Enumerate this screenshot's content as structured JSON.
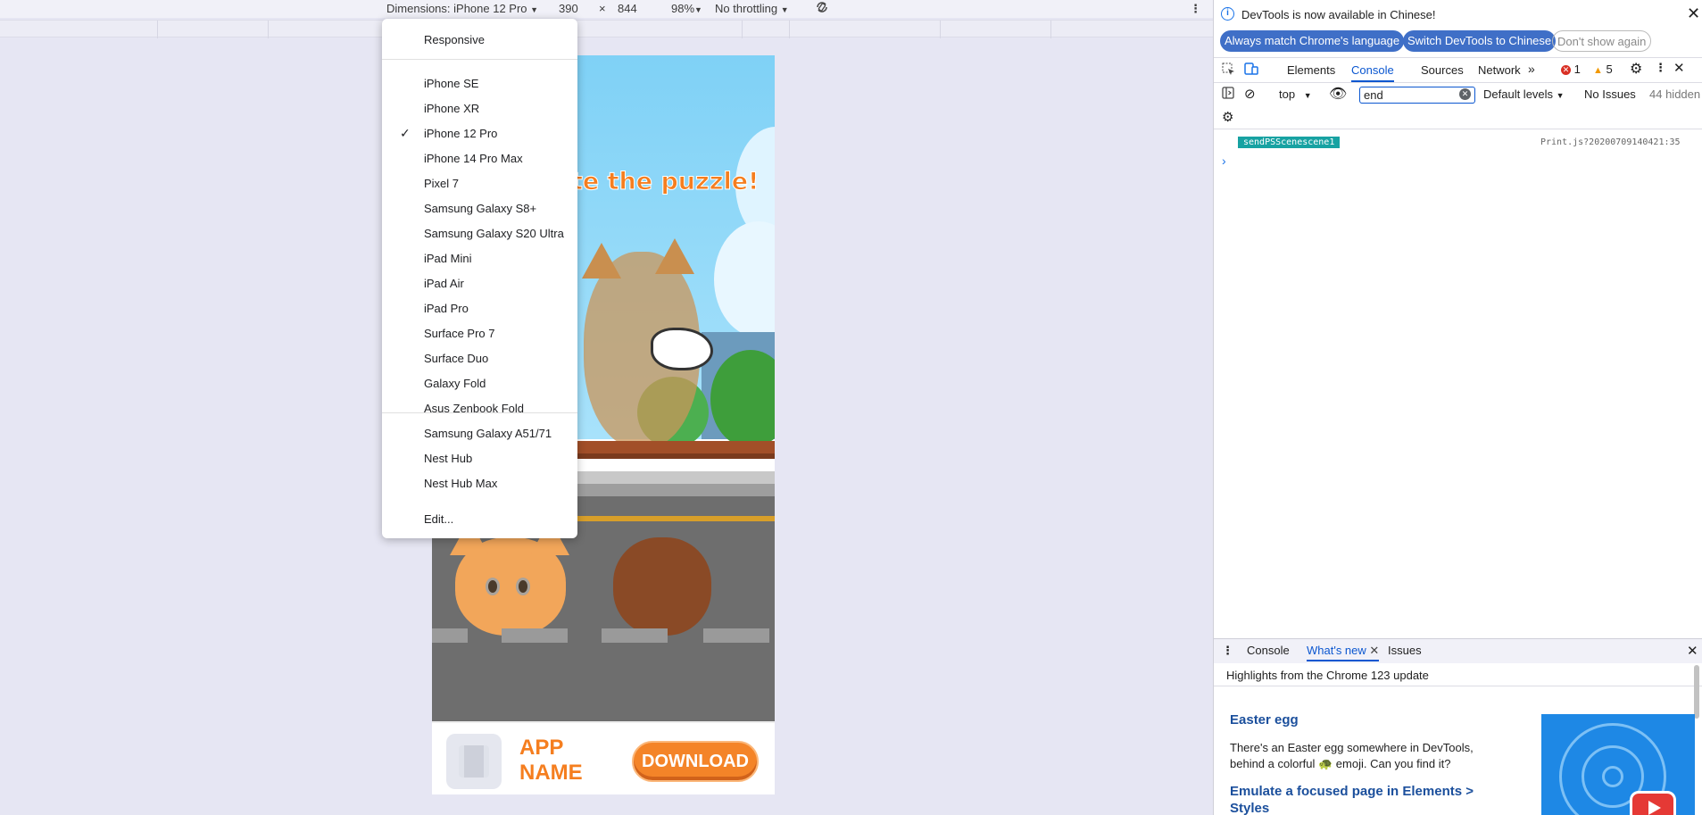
{
  "device_toolbar": {
    "dimensions_label": "Dimensions: iPhone 12 Pro",
    "width": "390",
    "times": "×",
    "height": "844",
    "zoom": "98%",
    "throttling": "No throttling"
  },
  "device_menu": {
    "responsive": "Responsive",
    "devices": [
      "iPhone SE",
      "iPhone XR",
      "iPhone 12 Pro",
      "iPhone 14 Pro Max",
      "Pixel 7",
      "Samsung Galaxy S8+",
      "Samsung Galaxy S20 Ultra",
      "iPad Mini",
      "iPad Air",
      "iPad Pro",
      "Surface Pro 7",
      "Surface Duo",
      "Galaxy Fold",
      "Asus Zenbook Fold",
      "Samsung Galaxy A51/71",
      "Nest Hub",
      "Nest Hub Max"
    ],
    "selected": "iPhone 12 Pro",
    "checkmark": "✓",
    "edit": "Edit..."
  },
  "game": {
    "headline": "te the puzzle!",
    "ad_app_name": "APP NAME",
    "ad_download": "DOWNLOAD"
  },
  "devtools": {
    "info_text": "DevTools is now available in Chinese!",
    "btn_always_match": "Always match Chrome's language",
    "btn_switch": "Switch DevTools to Chinese",
    "btn_dont_show": "Don't show again",
    "tabs": [
      "Elements",
      "Console",
      "Sources",
      "Network"
    ],
    "active_tab": "Console",
    "errors_count": "1",
    "warnings_count": "5",
    "context": "top",
    "filter_value": "end",
    "levels": "Default levels",
    "no_issues": "No Issues",
    "hidden": "44 hidden",
    "log_message": "sendPSScenescene1",
    "log_source": "Print.js?20200709140421:35"
  },
  "drawer": {
    "tabs": [
      "Console",
      "What's new",
      "Issues"
    ],
    "active_tab": "What's new",
    "highlights": "Highlights from the Chrome 123 update",
    "item1_title": "Easter egg",
    "item1_text_1": "There's an Easter egg somewhere in DevTools,",
    "item1_text_2": "behind a colorful 🐢 emoji. Can you find it?",
    "item2_title_1": "Emulate a focused page in Elements >",
    "item2_title_2": "Styles"
  }
}
